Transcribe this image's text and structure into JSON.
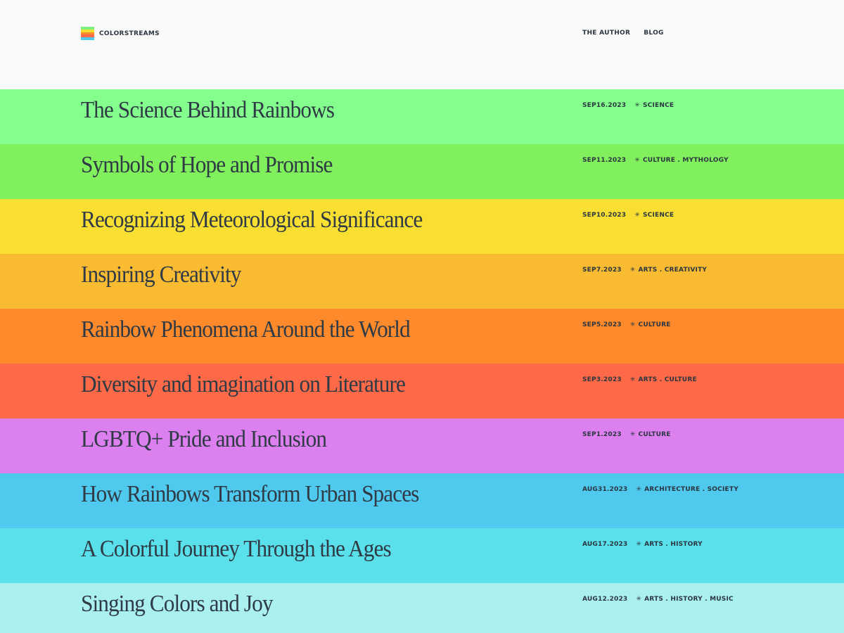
{
  "brand": {
    "name": "COLORSTREAMS",
    "logo_stripes": [
      "#7cf07c",
      "#f8de33",
      "#ff8c2a",
      "#ff6a48",
      "#4fc8ef"
    ]
  },
  "nav": {
    "items": [
      {
        "label": "THE AUTHOR"
      },
      {
        "label": "BLOG"
      }
    ]
  },
  "posts": [
    {
      "title": "The Science Behind Rainbows",
      "date": "SEP16.2023",
      "tags": "SCIENCE",
      "color": "#84ff8e"
    },
    {
      "title": "Symbols of Hope and Promise",
      "date": "SEP11.2023",
      "tags": "CULTURE . MYTHOLOGY",
      "color": "#80f05c"
    },
    {
      "title": "Recognizing Meteorological Significance",
      "date": "SEP10.2023",
      "tags": "SCIENCE",
      "color": "#f9df31"
    },
    {
      "title": "Inspiring Creativity",
      "date": "SEP7.2023",
      "tags": "ARTS . CREATIVITY",
      "color": "#f8bb31"
    },
    {
      "title": "Rainbow Phenomena Around the World",
      "date": "SEP5.2023",
      "tags": "CULTURE",
      "color": "#fe8a2c"
    },
    {
      "title": "Diversity and imagination on Literature",
      "date": "SEP3.2023",
      "tags": "ARTS . CULTURE",
      "color": "#fe6a48"
    },
    {
      "title": "LGBTQ+ Pride and Inclusion",
      "date": "SEP1.2023",
      "tags": "CULTURE",
      "color": "#dd80ef"
    },
    {
      "title": "How Rainbows Transform Urban Spaces",
      "date": "AUG31.2023",
      "tags": "ARCHITECTURE . SOCIETY",
      "color": "#50c9ef"
    },
    {
      "title": "A Colorful Journey Through the Ages",
      "date": "AUG17.2023",
      "tags": "ARTS . HISTORY",
      "color": "#5ae0ea"
    },
    {
      "title": "Singing Colors and Joy",
      "date": "AUG12.2023",
      "tags": "ARTS . HISTORY . MUSIC",
      "color": "#aaf0ef"
    }
  ],
  "meta_icon": "star-icon",
  "meta_glyph": "✳"
}
